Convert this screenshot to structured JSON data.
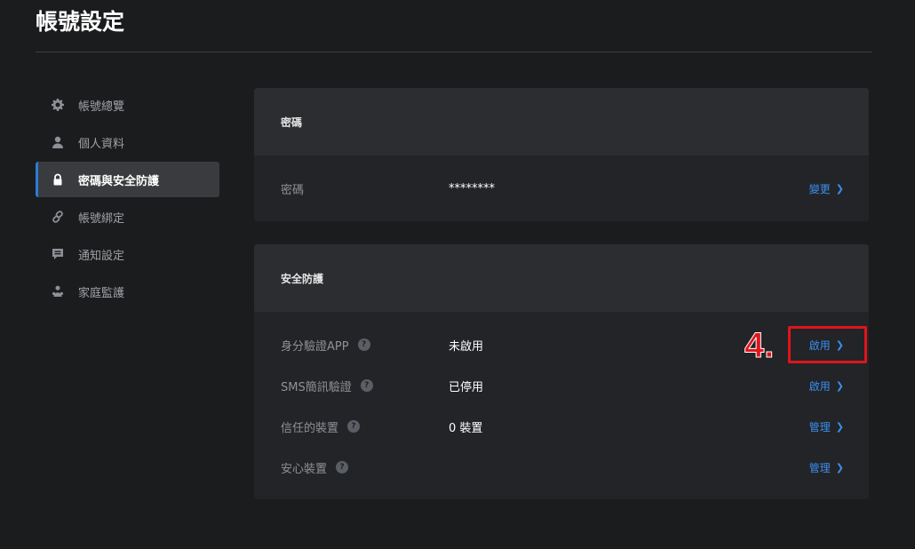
{
  "page": {
    "title": "帳號設定"
  },
  "sidebar": {
    "items": [
      {
        "label": "帳號總覽",
        "icon": "gear-icon",
        "active": false
      },
      {
        "label": "個人資料",
        "icon": "user-icon",
        "active": false
      },
      {
        "label": "密碼與安全防護",
        "icon": "lock-icon",
        "active": true
      },
      {
        "label": "帳號綁定",
        "icon": "link-icon",
        "active": false
      },
      {
        "label": "通知設定",
        "icon": "message-icon",
        "active": false
      },
      {
        "label": "家庭監護",
        "icon": "family-icon",
        "active": false
      }
    ]
  },
  "password_card": {
    "title": "密碼",
    "rows": [
      {
        "label": "密碼",
        "value": "********",
        "action": "變更"
      }
    ]
  },
  "security_card": {
    "title": "安全防護",
    "rows": [
      {
        "label": "身分驗證APP",
        "value": "未啟用",
        "action": "啟用"
      },
      {
        "label": "SMS簡訊驗證",
        "value": "已停用",
        "action": "啟用"
      },
      {
        "label": "信任的裝置",
        "value": "0 裝置",
        "action": "管理"
      },
      {
        "label": "安心裝置",
        "value": "",
        "action": "管理"
      }
    ]
  },
  "annotation": {
    "step": "4."
  },
  "colors": {
    "accent": "#2b7bd8",
    "link": "#3a8ff0",
    "highlight": "#e1141b"
  }
}
